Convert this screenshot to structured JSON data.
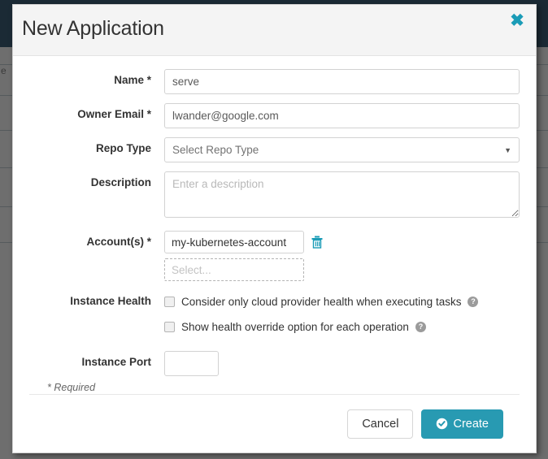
{
  "background": {
    "hidden_text": "e"
  },
  "modal": {
    "title": "New Application",
    "close_label": "✖",
    "close_icon": "close-icon",
    "accent_color": "#289ab2",
    "header_bg": "#f4f4f4",
    "fields": [
      {
        "key": "name",
        "label": "Name *",
        "type": "text",
        "value": "serve",
        "placeholder": ""
      },
      {
        "key": "owner_email",
        "label": "Owner Email *",
        "type": "text",
        "value": "lwander@google.com",
        "placeholder": ""
      },
      {
        "key": "repo_type",
        "label": "Repo Type",
        "type": "select",
        "value": "Select Repo Type",
        "caret_icon": "chevron-down-icon"
      },
      {
        "key": "description",
        "label": "Description",
        "type": "textarea",
        "value": "",
        "placeholder": "Enter a description"
      }
    ],
    "accounts": {
      "label": "Account(s) *",
      "value": "my-kubernetes-account",
      "delete_icon": "trash-icon",
      "select_placeholder": "Select..."
    },
    "instance_health": {
      "label": "Instance Health",
      "options": [
        {
          "label": "Consider only cloud provider health when executing tasks",
          "checked": false,
          "help_icon": "help-circle-icon",
          "help_glyph": "?"
        },
        {
          "label": "Show health override option for each operation",
          "checked": false,
          "help_icon": "help-circle-icon",
          "help_glyph": "?"
        }
      ]
    },
    "instance_port": {
      "label": "Instance Port",
      "value": "",
      "placeholder": ""
    },
    "required_note": "* Required",
    "footer": {
      "cancel_label": "Cancel",
      "create_label": "Create",
      "create_icon": "check-circle-icon"
    }
  }
}
